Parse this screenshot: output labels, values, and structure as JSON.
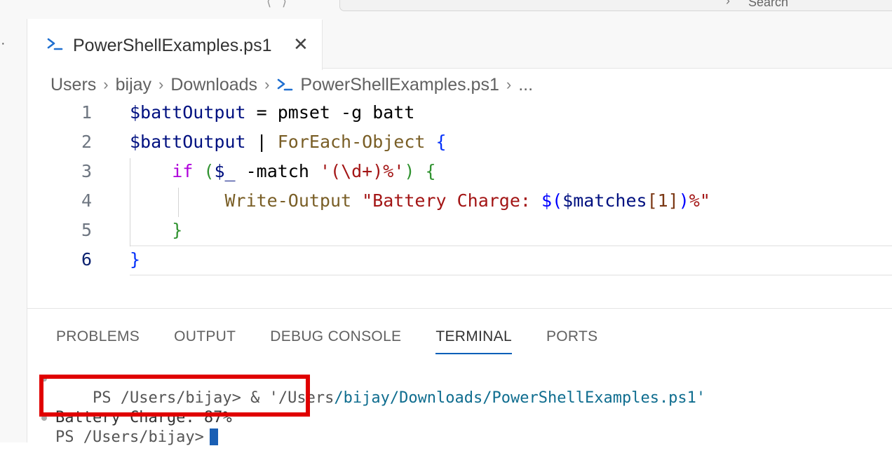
{
  "window": {
    "search_label": "Search"
  },
  "tab": {
    "title": "PowerShellExamples.ps1"
  },
  "breadcrumb": {
    "items": [
      "Users",
      "bijay",
      "Downloads",
      "PowerShellExamples.ps1",
      "..."
    ]
  },
  "editor": {
    "lines": [
      {
        "num": "1",
        "var": "$battOutput",
        "rest": " = pmset -g batt"
      },
      {
        "num": "2",
        "var": "$battOutput",
        "pipe": " | ",
        "cmd": "ForEach-Object",
        "brace": " {"
      },
      {
        "num": "3",
        "kw": "if",
        "open": " (",
        "var": "$_",
        "op": " -match ",
        "str": "'(\\d+)%'",
        "close": ") ",
        "brace": "{"
      },
      {
        "num": "4",
        "cmd": "Write-Output",
        "str_a": " \"Battery Charge: ",
        "sub_a": "$(",
        "sub_var": "$matches",
        "idx": "[1]",
        "sub_b": ")",
        "str_b": "%\""
      },
      {
        "num": "5",
        "brace": "}"
      },
      {
        "num": "6",
        "brace": "}"
      }
    ]
  },
  "panel": {
    "tabs": [
      "PROBLEMS",
      "OUTPUT",
      "DEBUG CONSOLE",
      "TERMINAL",
      "PORTS"
    ],
    "active_tab": "TERMINAL"
  },
  "terminal": {
    "line1_prompt": "PS /Users/bijay> & '/Users",
    "line1_path": "/bijay/Downloads/PowerShellExamples.ps1'",
    "line2": "Battery Charge: 87%",
    "line3_prompt": "PS /Users/bijay>"
  },
  "colors": {
    "accent": "#005fb8",
    "highlight_border": "#e00000",
    "cursor": "#1a5fb4"
  }
}
